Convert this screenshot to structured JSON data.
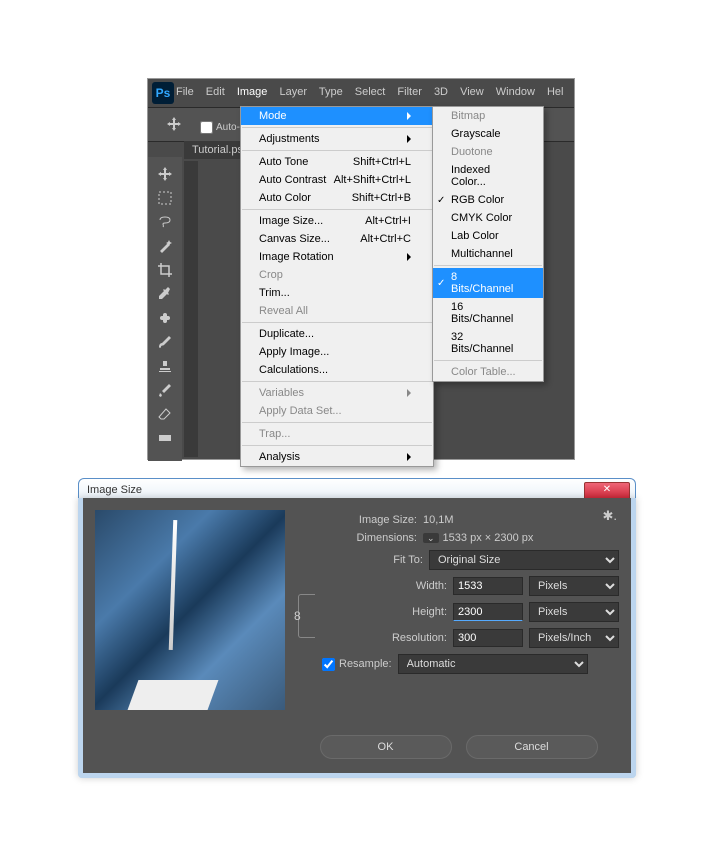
{
  "ps": {
    "logo": "Ps",
    "menu": [
      "File",
      "Edit",
      "Image",
      "Layer",
      "Type",
      "Select",
      "Filter",
      "3D",
      "View",
      "Window",
      "Hel"
    ],
    "auto_select": "Auto-S",
    "tab": "Tutorial.psd",
    "image_menu": {
      "mode": "Mode",
      "adjustments": "Adjustments",
      "auto_tone": "Auto Tone",
      "auto_tone_sc": "Shift+Ctrl+L",
      "auto_contrast": "Auto Contrast",
      "auto_contrast_sc": "Alt+Shift+Ctrl+L",
      "auto_color": "Auto Color",
      "auto_color_sc": "Shift+Ctrl+B",
      "image_size": "Image Size...",
      "image_size_sc": "Alt+Ctrl+I",
      "canvas_size": "Canvas Size...",
      "canvas_size_sc": "Alt+Ctrl+C",
      "image_rotation": "Image Rotation",
      "crop": "Crop",
      "trim": "Trim...",
      "reveal_all": "Reveal All",
      "duplicate": "Duplicate...",
      "apply_image": "Apply Image...",
      "calculations": "Calculations...",
      "variables": "Variables",
      "apply_data_set": "Apply Data Set...",
      "trap": "Trap...",
      "analysis": "Analysis"
    },
    "mode_menu": {
      "bitmap": "Bitmap",
      "grayscale": "Grayscale",
      "duotone": "Duotone",
      "indexed": "Indexed Color...",
      "rgb": "RGB Color",
      "cmyk": "CMYK Color",
      "lab": "Lab Color",
      "multichannel": "Multichannel",
      "b8": "8 Bits/Channel",
      "b16": "16 Bits/Channel",
      "b32": "32 Bits/Channel",
      "color_table": "Color Table..."
    }
  },
  "dlg": {
    "title": "Image Size",
    "close": "✕",
    "info_lbl": "Image Size:",
    "info_val": "10,1M",
    "dim_lbl": "Dimensions:",
    "dim_val": "1533 px  ×  2300 px",
    "fit_lbl": "Fit To:",
    "fit_val": "Original Size",
    "width_lbl": "Width:",
    "width_val": "1533",
    "width_unit": "Pixels",
    "height_lbl": "Height:",
    "height_val": "2300",
    "height_unit": "Pixels",
    "res_lbl": "Resolution:",
    "res_val": "300",
    "res_unit": "Pixels/Inch",
    "resample_lbl": "Resample:",
    "resample_val": "Automatic",
    "ok": "OK",
    "cancel": "Cancel"
  }
}
